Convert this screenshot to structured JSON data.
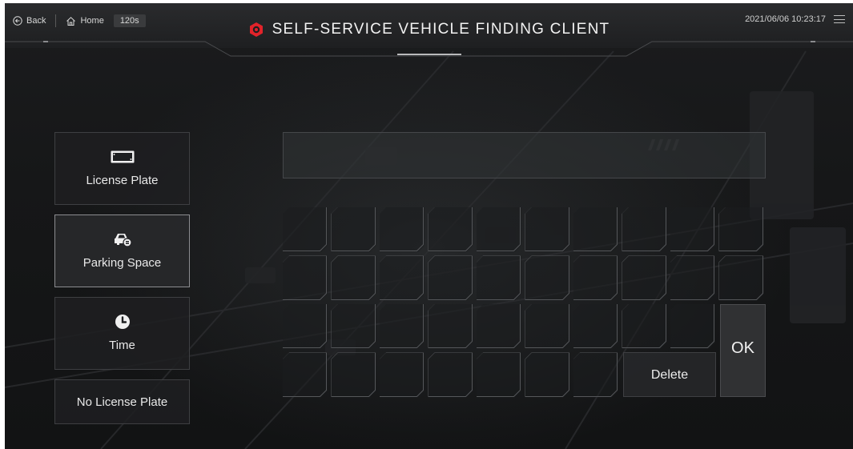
{
  "header": {
    "back_label": "Back",
    "home_label": "Home",
    "timer": "120s",
    "title": "SELF-SERVICE VEHICLE FINDING CLIENT",
    "datetime": "2021/06/06 10:23:17"
  },
  "modes": [
    {
      "label": "License Plate",
      "icon": "license-plate-icon",
      "active": false
    },
    {
      "label": "Parking Space",
      "icon": "parking-space-car-icon",
      "active": true
    },
    {
      "label": "Time",
      "icon": "clock-icon",
      "active": false
    },
    {
      "label": "No License Plate",
      "icon": "",
      "active": false
    }
  ],
  "input": {
    "value": ""
  },
  "keyboard": {
    "delete_label": "Delete",
    "ok_label": "OK"
  },
  "colors": {
    "accent": "#e2232a",
    "background": "#151617",
    "key_border": "#55575a"
  }
}
